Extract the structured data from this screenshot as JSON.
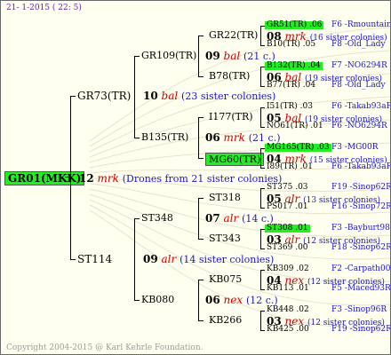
{
  "header": {
    "date": "21-  1-2015 ( 22:  5)"
  },
  "footer": {
    "copyright": "Copyright 2004-2015 @ Karl Kehrle Foundation."
  },
  "root": {
    "label": "GR01(MKK)",
    "num": "12",
    "mark": "mrk",
    "note": "(Drones from 21 sister colonies)"
  },
  "gen1": [
    {
      "label": "GR73(TR)",
      "num": "10",
      "mark": "bal",
      "note": "(23 sister colonies)"
    },
    {
      "label": "ST114",
      "num": "09",
      "mark": "alr",
      "note": "(14 sister colonies)"
    }
  ],
  "gen2": [
    {
      "label": "GR109(TR)",
      "num": "09",
      "mark": "bal",
      "note": "(21 c.)"
    },
    {
      "label": "B135(TR)",
      "num": "06",
      "mark": "mrk",
      "note": "(21 c.)"
    },
    {
      "label": "ST348",
      "num": "07",
      "mark": "alr",
      "note": "(14 c.)"
    },
    {
      "label": "KB080",
      "num": "06",
      "mark": "nex",
      "note": "(12 c.)"
    }
  ],
  "gen3": [
    {
      "label": "GR22(TR)"
    },
    {
      "label": "B78(TR)"
    },
    {
      "label": "I177(TR)"
    },
    {
      "label": "MG60(TR)"
    },
    {
      "label": "ST318"
    },
    {
      "label": "ST343"
    },
    {
      "label": "KB075"
    },
    {
      "label": "KB266"
    }
  ],
  "gen4": [
    {
      "top": "GR51(TR) .06",
      "top_origin": "F6 -Rmountain06Q",
      "num": "08",
      "mark": "mrk",
      "note": "(16 sister colonies)",
      "bottom": "B10(TR) .05",
      "bottom_origin": "F8 -Old_Lady"
    },
    {
      "top": "B132(TR) .04",
      "top_origin": "F7 -NO6294R",
      "num": "06",
      "mark": "bal",
      "note": "(19 sister colonies)",
      "bottom": "B77(TR) .04",
      "bottom_origin": "F8 -Old_Lady"
    },
    {
      "top": "I51(TR) .03",
      "top_origin": "F6 -Takab93aR",
      "num": "05",
      "mark": "bal",
      "note": "(19 sister colonies)",
      "bottom": "NO61(TR) .01",
      "bottom_origin": "F6 -NO6294R"
    },
    {
      "top": "MG165(TR) .03",
      "top_origin": "F3 -MG00R",
      "num": "04",
      "mark": "mrk",
      "note": "(15 sister colonies)",
      "bottom": "I89(TR) .01",
      "bottom_origin": "F6 -Takab93aR"
    },
    {
      "top": "ST375 .03",
      "top_origin": "F19 -Sinop62R",
      "num": "05",
      "mark": "alr",
      "note": "(13 sister colonies)",
      "bottom": "PS017 .01",
      "bottom_origin": "F16 -Sinop72R"
    },
    {
      "top": "ST308 .01",
      "top_origin": "F3 -Bayburt98-3R",
      "num": "03",
      "mark": "alr",
      "note": "(12 sister colonies)",
      "bottom": "ST369 .00",
      "bottom_origin": "F18 -Sinop62R"
    },
    {
      "top": "KB309 .02",
      "top_origin": "F2 -Carpath00R",
      "num": "04",
      "mark": "nex",
      "note": "(12 sister colonies)",
      "bottom": "KB113 .01",
      "bottom_origin": "F5 -Maced93R"
    },
    {
      "top": "KB448 .02",
      "top_origin": "F3 -Sinop96R",
      "num": "03",
      "mark": "nex",
      "note": "(12 sister colonies)",
      "bottom": "KB425 .00",
      "bottom_origin": "F19 -Sinop62R"
    }
  ]
}
